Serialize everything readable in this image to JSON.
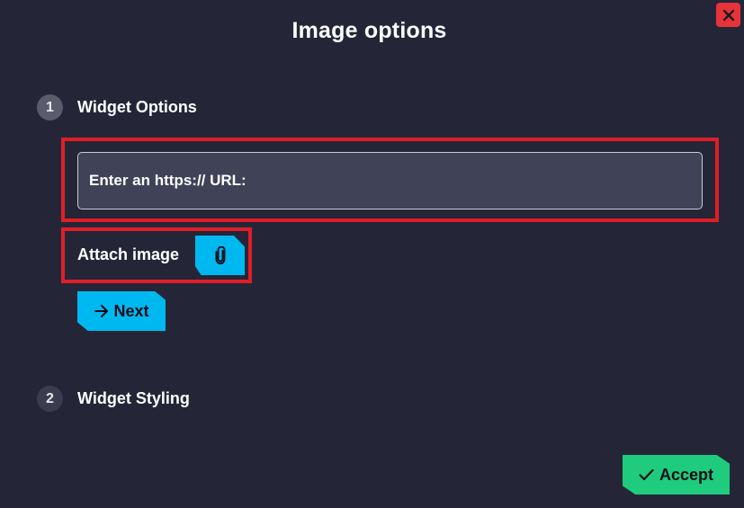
{
  "dialog": {
    "title": "Image options",
    "close_icon": "close-x-icon"
  },
  "steps": [
    {
      "number": "1",
      "label": "Widget Options",
      "active": true
    },
    {
      "number": "2",
      "label": "Widget Styling",
      "active": false
    }
  ],
  "url_input": {
    "placeholder": "Enter an https:// URL:",
    "value": ""
  },
  "attach": {
    "label": "Attach image",
    "icon": "paperclip-icon"
  },
  "next_button": {
    "label": "Next",
    "icon": "arrow-right-icon"
  },
  "accept_button": {
    "label": "Accept",
    "icon": "checkmark-icon"
  },
  "colors": {
    "background": "#242638",
    "accent_blue": "#00b8f0",
    "accept_green": "#1fcb7c",
    "highlight_red": "#e01e26",
    "close_red": "#e8323a",
    "input_background": "#404357"
  }
}
